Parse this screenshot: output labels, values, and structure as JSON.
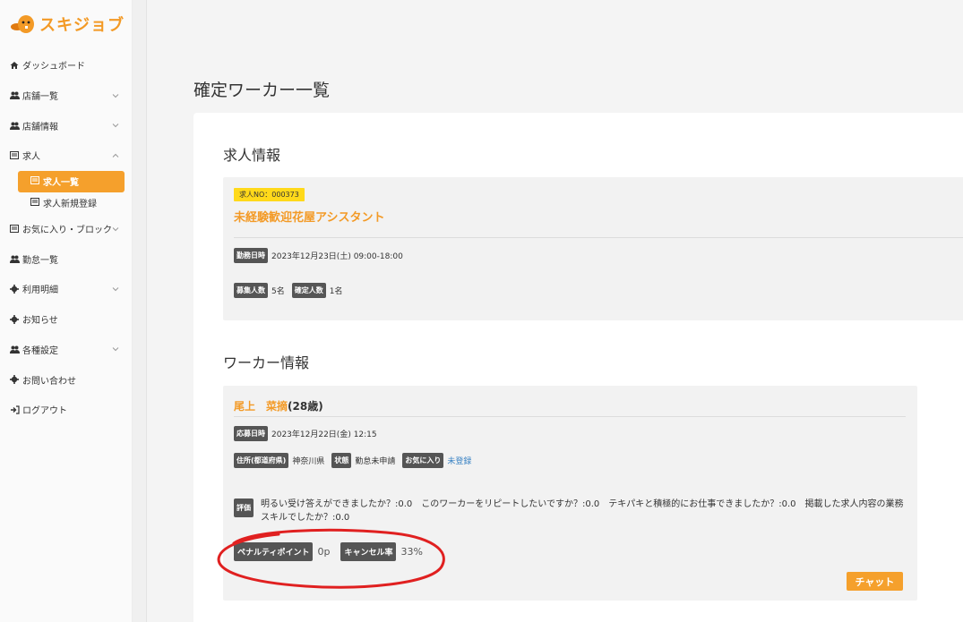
{
  "brand": {
    "name": "スキジョブ",
    "color": "#f39a26"
  },
  "sidebar": {
    "items": [
      {
        "label": "ダッシュボード",
        "icon": "home-icon",
        "chevron": "none"
      },
      {
        "label": "店舗一覧",
        "icon": "users-icon",
        "chevron": "down"
      },
      {
        "label": "店舗情報",
        "icon": "users-icon",
        "chevron": "down"
      },
      {
        "label": "求人",
        "icon": "list-icon",
        "chevron": "up"
      }
    ],
    "sub_items": [
      {
        "label": "求人一覧",
        "active": true
      },
      {
        "label": "求人新規登録",
        "active": false
      }
    ],
    "items2": [
      {
        "label": "お気に入り・ブロック",
        "icon": "list-icon",
        "chevron": "down"
      },
      {
        "label": "勤怠一覧",
        "icon": "users-icon",
        "chevron": "none"
      },
      {
        "label": "利用明細",
        "icon": "gear-icon",
        "chevron": "down"
      },
      {
        "label": "お知らせ",
        "icon": "gear-icon",
        "chevron": "none"
      },
      {
        "label": "各種設定",
        "icon": "users-icon",
        "chevron": "down"
      },
      {
        "label": "お問い合わせ",
        "icon": "gear-icon",
        "chevron": "none"
      },
      {
        "label": "ログアウト",
        "icon": "logout-icon",
        "chevron": "none"
      }
    ]
  },
  "page": {
    "title": "確定ワーカー一覧"
  },
  "job": {
    "section_title": "求人情報",
    "job_no_label": "求人NO：000373",
    "title": "未経験歓迎花屋アシスタント",
    "work_date_label": "勤務日時",
    "work_date": "2023年12月23日(土) 09:00-18:00",
    "recruit_label": "募集人数",
    "recruit_count": "5名",
    "confirmed_label": "確定人数",
    "confirmed_count": "1名"
  },
  "worker": {
    "section_title": "ワーカー情報",
    "name": "尾上　菜摘",
    "age": "(28歳)",
    "applied_label": "応募日時",
    "applied_at": "2023年12月22日(金) 12:15",
    "address_label": "住所(都道府県)",
    "address": "神奈川県",
    "status_label": "状態",
    "status": "勤怠未申請",
    "favorite_label": "お気に入り",
    "favorite": "未登録",
    "eval_label": "評価",
    "eval_text": "明るい受け答えができましたか？:0.0　このワーカーをリピートしたいですか？:0.0　テキパキと積極的にお仕事できましたか？:0.0　掲載した求人内容の業務スキルでしたか？:0.0",
    "penalty_label": "ペナルティポイント",
    "penalty": "0p",
    "cancel_label": "キャンセル率",
    "cancel_rate": "33%",
    "chat_label": "チャット"
  },
  "colors": {
    "accent": "#f5a02c",
    "annotation": "#e02020",
    "badge": "#ffd91a",
    "tag": "#555555"
  }
}
